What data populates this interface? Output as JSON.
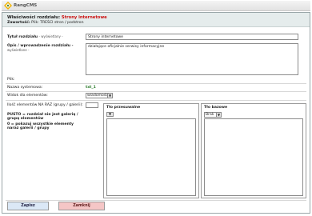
{
  "app": {
    "name": "RangCMS"
  },
  "header": {
    "title_prefix": "Właściwości rozdziału:",
    "title_name": "Strony internetowe",
    "contents_label": "Zawartość:",
    "contents_value": "Plik: TREŚCI stron / podstron"
  },
  "form": {
    "title_label": "Tytuł rozdziału",
    "title_sublabel": "- wyświetlany -",
    "title_value": "Strony internetowe",
    "desc_label": "Opis / wprowadzenie rozdziału -",
    "desc_sublabel": "wyświetlane -",
    "desc_value": "działające oficjalnie serwisy informacyjne",
    "file_label": "Plik:",
    "system_name_label": "Nazwa systemowa:",
    "system_name_value": "txt_1",
    "view_label": "Widok dla elementów:",
    "view_value": "wiadomości",
    "count_label": "Ilość elementów NA RAZ (grupy / galerii):",
    "count_value": "",
    "empty_note": "PUSTO = rozdział nie jest galerią / grupą elementów",
    "zero_note": "0 = pokazuj wszystkie elementy naraz galerii / grupy",
    "pane_left_title": "Tło przesuwalne",
    "pane_right_title": "Tło bazowe",
    "pane_right_select": "Brak"
  },
  "buttons": {
    "save": "Zapisz",
    "close": "Zamknij"
  },
  "colors": {
    "header_bg": "#e5ecec",
    "highlight": "#cc1111",
    "system_name": "#2a7a2a"
  }
}
